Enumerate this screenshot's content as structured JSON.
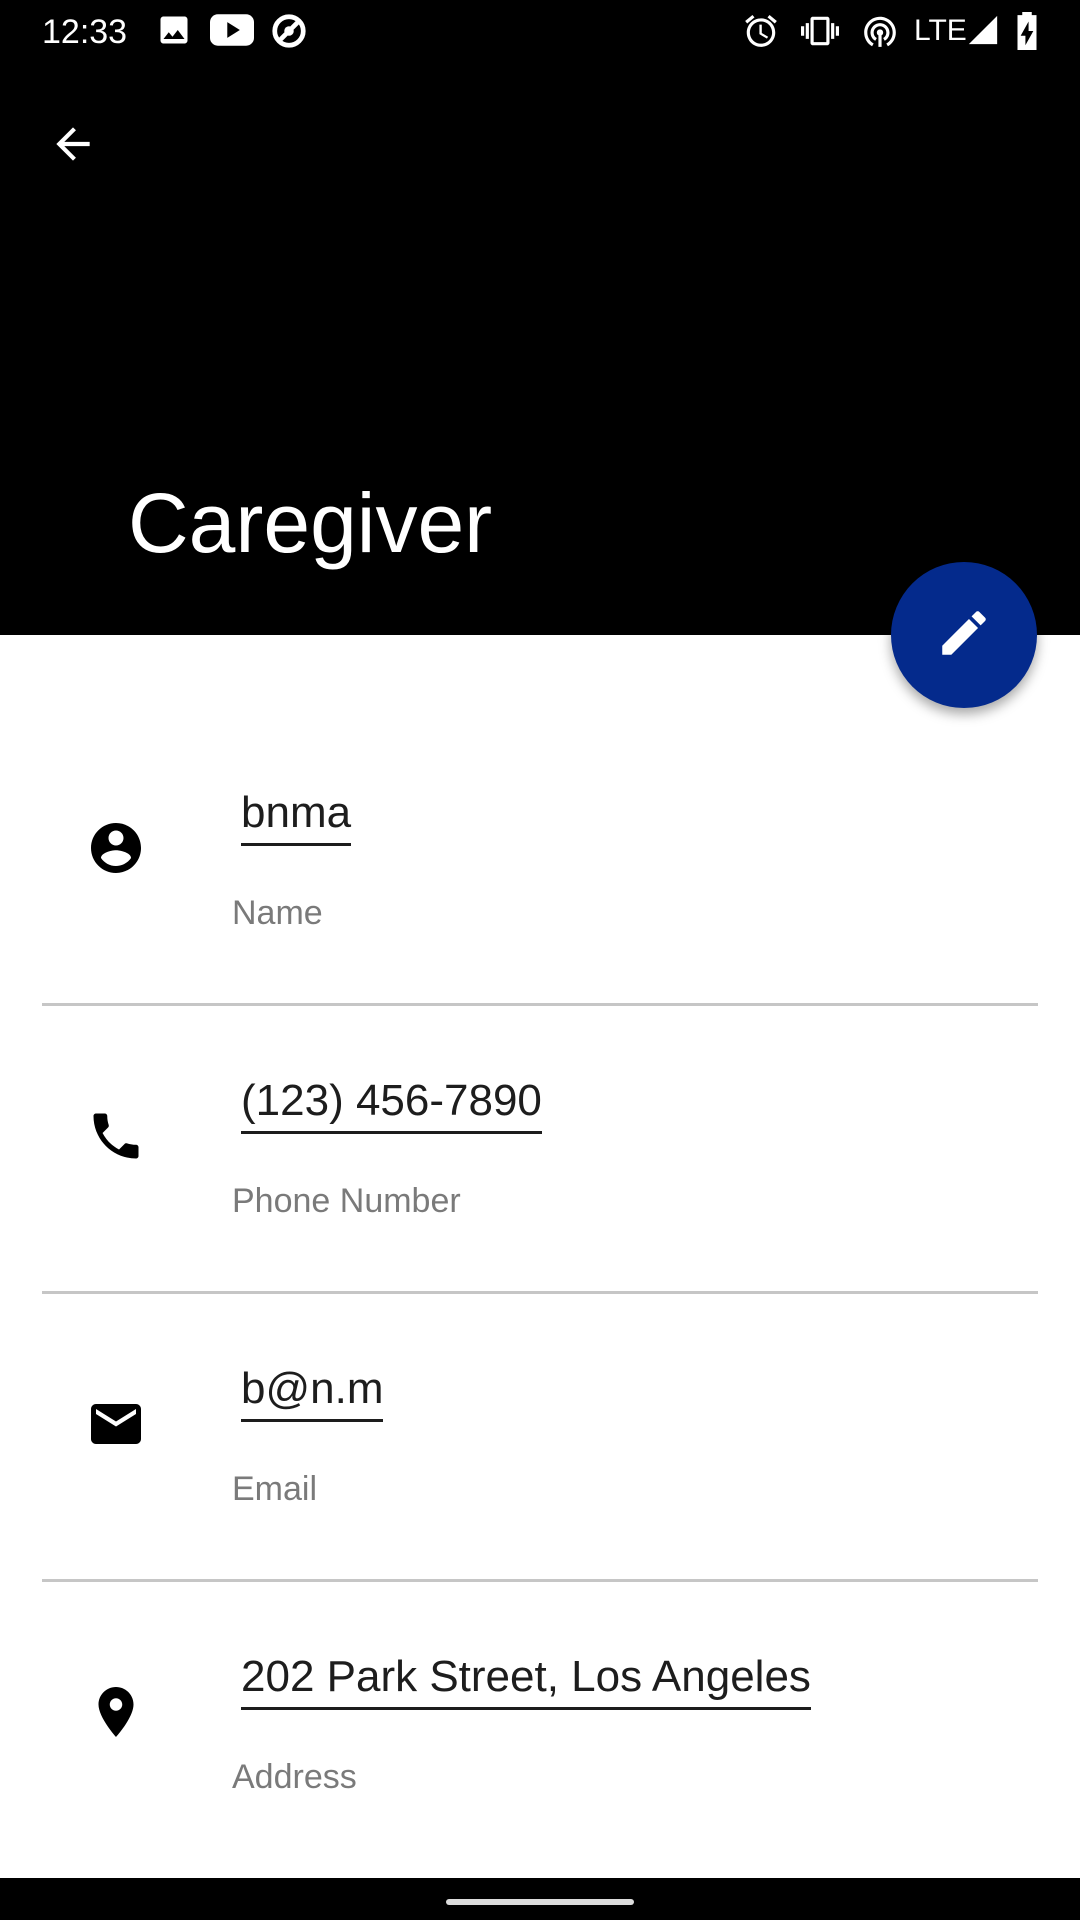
{
  "status_bar": {
    "time": "12:33",
    "network_label": "LTE",
    "left_icons": [
      "image-icon",
      "youtube-icon",
      "data-saver-icon"
    ],
    "right_icons": [
      "alarm-icon",
      "vibrate-icon",
      "hotspot-icon",
      "signal-icon",
      "battery-charging-icon"
    ]
  },
  "app_bar": {
    "title": "Caregiver",
    "back_icon": "arrow-back-icon",
    "background": "#000000"
  },
  "fab": {
    "icon": "edit-icon",
    "color": "#042a8c"
  },
  "fields": [
    {
      "value": "bnma",
      "label": "Name",
      "icon": "account-circle-icon"
    },
    {
      "value": "(123) 456-7890",
      "label": "Phone Number",
      "icon": "phone-icon"
    },
    {
      "value": "b@n.m",
      "label": "Email",
      "icon": "email-icon"
    },
    {
      "value": "202 Park Street, Los Angeles",
      "label": "Address",
      "icon": "location-pin-icon"
    }
  ]
}
